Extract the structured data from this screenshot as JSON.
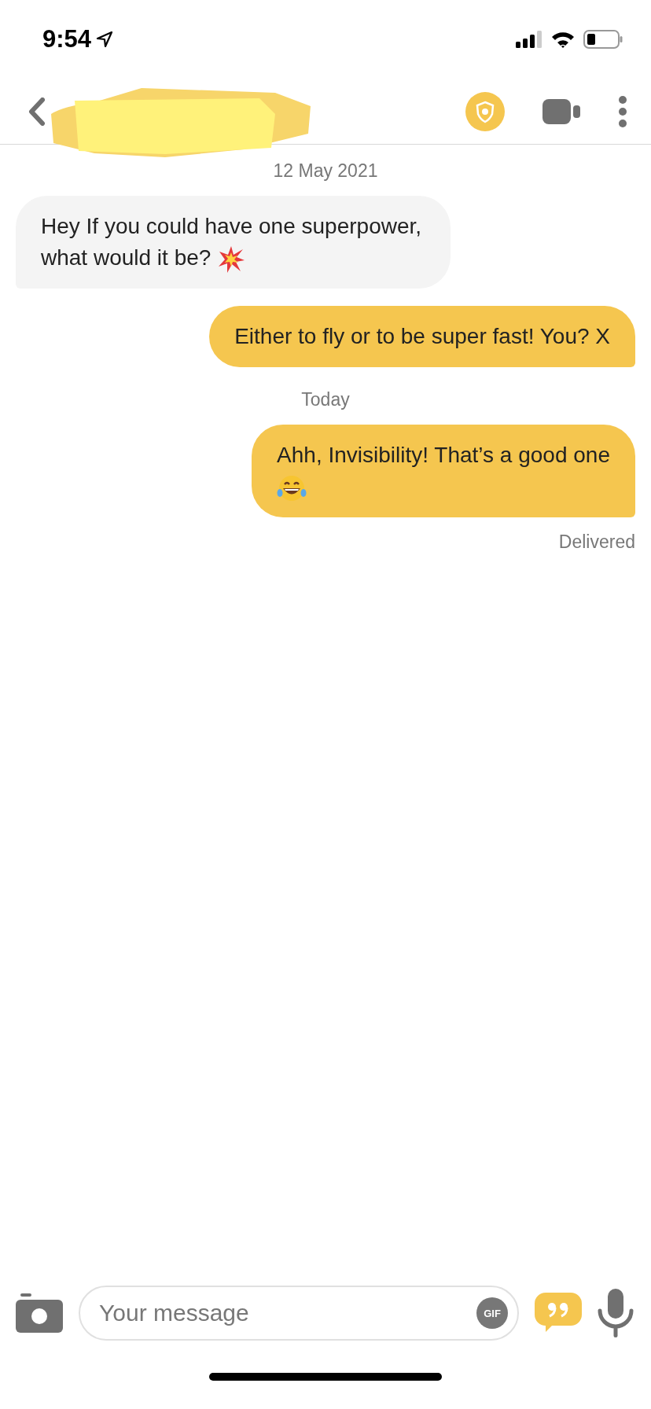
{
  "status_bar": {
    "time": "9:54"
  },
  "messages": [
    {
      "kind": "date",
      "text": "12 May 2021"
    },
    {
      "kind": "received",
      "text": "Hey If you could have one superpower, what would it be?",
      "icon": {
        "kind": "burst"
      }
    },
    {
      "kind": "sent",
      "text": "Either to fly or to be super fast! You? X"
    },
    {
      "kind": "date",
      "text": "Today"
    },
    {
      "kind": "sent",
      "text": "Ahh, Invisibility! That’s a good one",
      "icon": {
        "kind": "laugh"
      }
    },
    {
      "kind": "status",
      "text": "Delivered"
    }
  ],
  "composer": {
    "placeholder": "Your message",
    "gif_label": "GIF"
  }
}
